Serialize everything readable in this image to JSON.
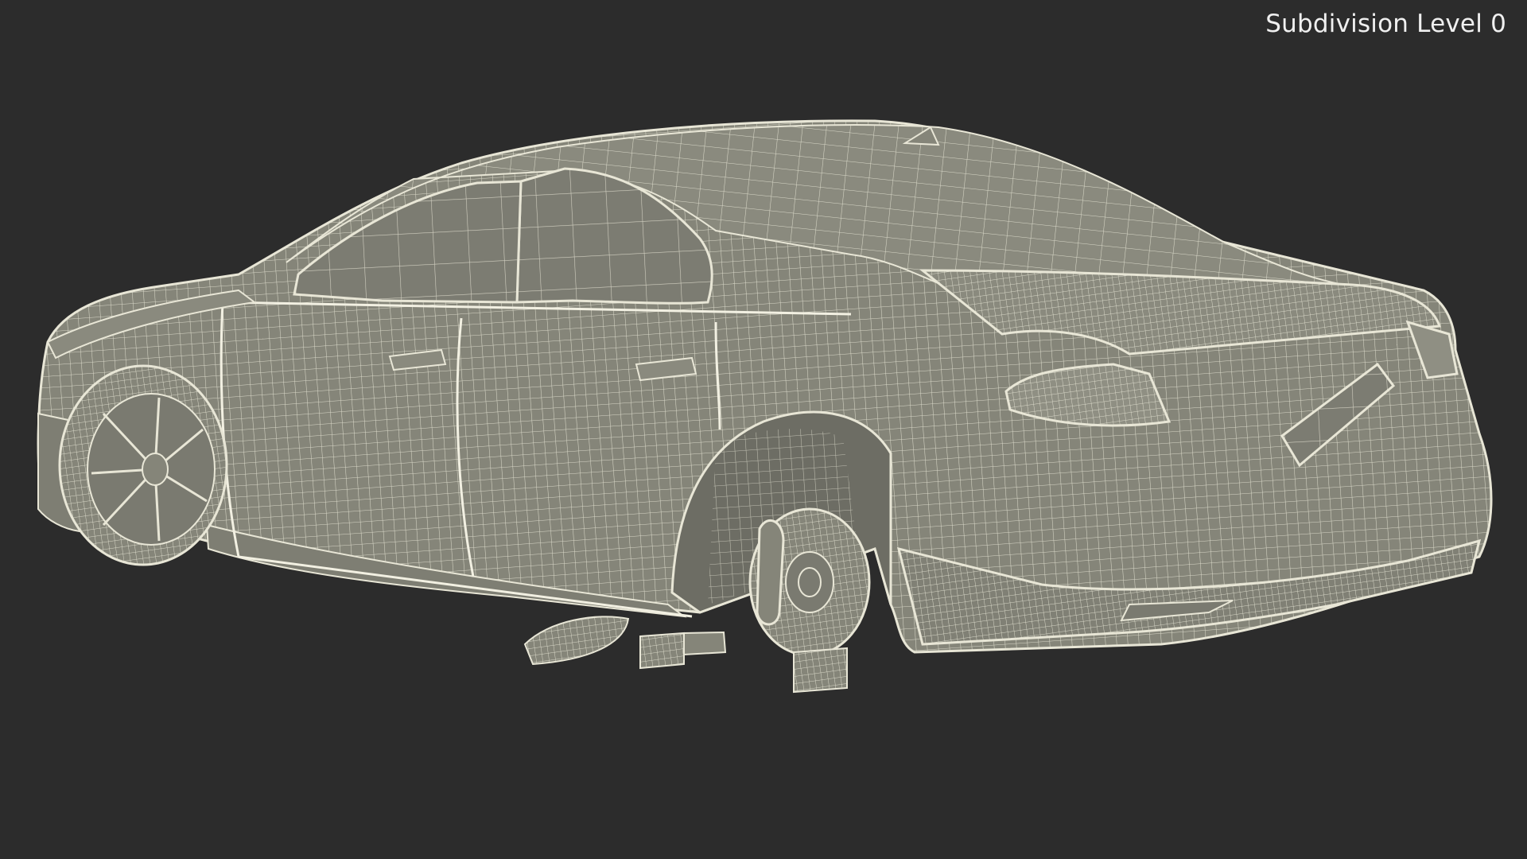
{
  "viewport": {
    "subdivision_label": "Subdivision Level 0",
    "background_color": "#2c2c2c",
    "surface_color": "#858579",
    "wire_color": "#e8e6d6"
  }
}
